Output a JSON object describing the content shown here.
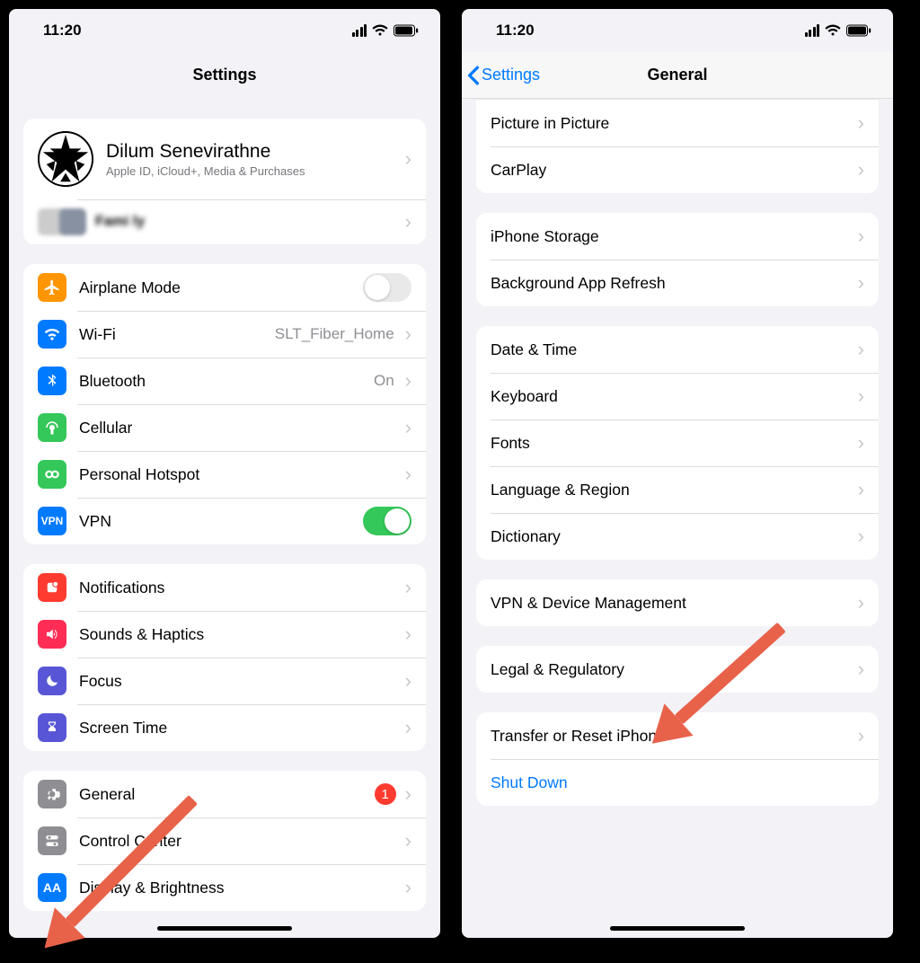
{
  "status": {
    "time": "11:20"
  },
  "left": {
    "title": "Settings",
    "profile": {
      "name": "Dilum Senevirathne",
      "sub": "Apple ID, iCloud+, Media & Purchases"
    },
    "family_blur_text": "Fami ly",
    "conn": {
      "airplane": "Airplane Mode",
      "wifi": "Wi-Fi",
      "wifi_val": "SLT_Fiber_Home",
      "bt": "Bluetooth",
      "bt_val": "On",
      "cell": "Cellular",
      "hotspot": "Personal Hotspot",
      "vpn": "VPN"
    },
    "notif": {
      "notifications": "Notifications",
      "sounds": "Sounds & Haptics",
      "focus": "Focus",
      "screentime": "Screen Time"
    },
    "dev": {
      "general": "General",
      "general_badge": "1",
      "control": "Control Center",
      "display": "Display & Brightness"
    }
  },
  "right": {
    "back": "Settings",
    "title": "General",
    "g1": {
      "pip": "Picture in Picture",
      "carplay": "CarPlay"
    },
    "g2": {
      "storage": "iPhone Storage",
      "refresh": "Background App Refresh"
    },
    "g3": {
      "date": "Date & Time",
      "keyboard": "Keyboard",
      "fonts": "Fonts",
      "lang": "Language & Region",
      "dict": "Dictionary"
    },
    "g4": {
      "vpnmgmt": "VPN & Device Management"
    },
    "g5": {
      "legal": "Legal & Regulatory"
    },
    "g6": {
      "transfer": "Transfer or Reset iPhone",
      "shutdown": "Shut Down"
    }
  }
}
